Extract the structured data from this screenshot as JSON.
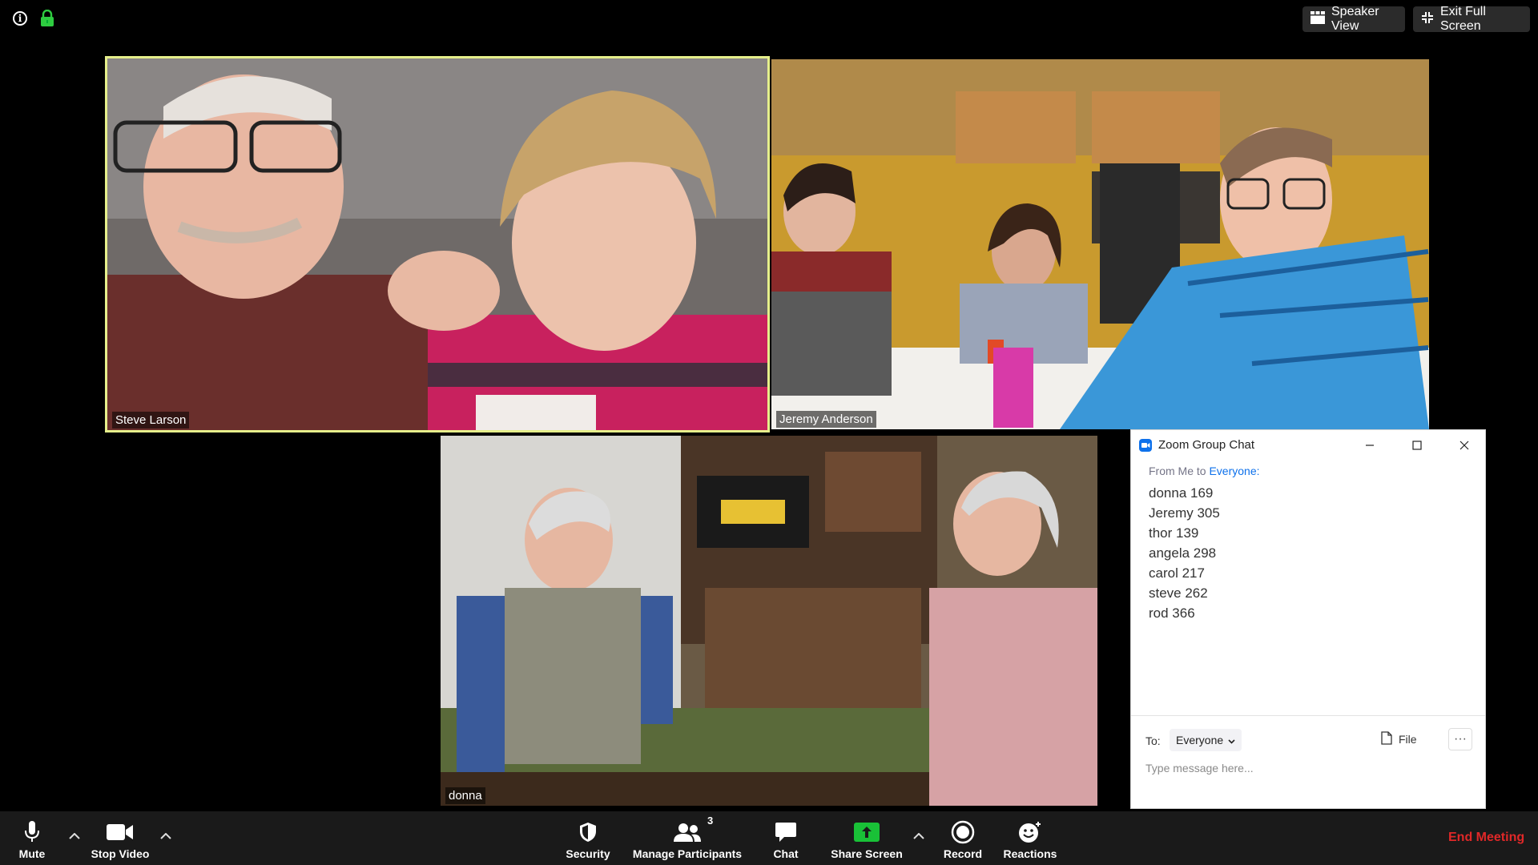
{
  "top_bar": {
    "info_icon": "info-icon",
    "lock_icon": "lock-icon",
    "speaker_view_label": "Speaker View",
    "exit_full_screen_label": "Exit Full Screen"
  },
  "videos": [
    {
      "name": "Steve Larson",
      "active_speaker": true
    },
    {
      "name": "Jeremy Anderson",
      "active_speaker": false
    },
    {
      "name": "donna",
      "active_speaker": false
    }
  ],
  "chat": {
    "title": "Zoom Group Chat",
    "from_prefix": "From Me to ",
    "from_recipient": "Everyone",
    "from_suffix": ":",
    "messages": [
      "donna 169",
      "Jeremy 305",
      "thor 139",
      "angela 298",
      "carol 217",
      "steve 262",
      "rod 366"
    ],
    "to_label": "To:",
    "to_value": "Everyone",
    "file_label": "File",
    "input_placeholder": "Type message here..."
  },
  "toolbar": {
    "mute_label": "Mute",
    "stop_video_label": "Stop Video",
    "security_label": "Security",
    "participants_label": "Manage Participants",
    "participants_count": "3",
    "chat_label": "Chat",
    "share_screen_label": "Share Screen",
    "record_label": "Record",
    "reactions_label": "Reactions",
    "end_meeting_label": "End Meeting"
  },
  "colors": {
    "active_speaker_border": "#e6ef8b",
    "share_screen_green": "#19c137",
    "end_meeting_red": "#e02828",
    "chat_link_blue": "#0e71eb"
  }
}
